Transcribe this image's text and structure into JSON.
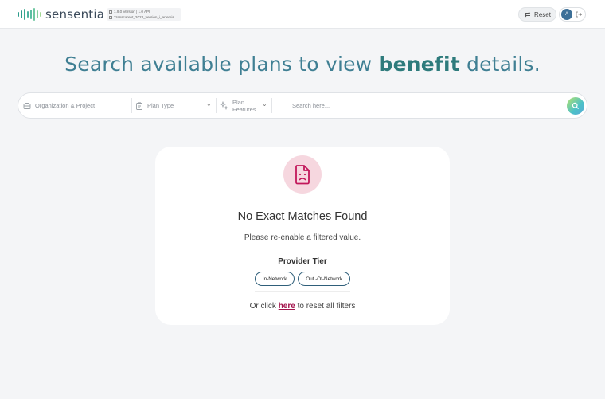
{
  "header": {
    "logo_text": "sensentia",
    "version_line1": "1.9.0 Version | 1.0 API",
    "version_line2": "Transcarent_2023_version_i_artemis",
    "reset_label": "Reset",
    "avatar_initial": "A"
  },
  "headline": {
    "part1": "Search available plans to view ",
    "emphasis": "benefit",
    "part2": " details."
  },
  "search": {
    "org_project": "Organization & Project",
    "plan_type": "Plan Type",
    "plan_features_line1": "Plan",
    "plan_features_line2": "Features",
    "placeholder": "Search here..."
  },
  "empty_state": {
    "title": "No Exact Matches Found",
    "subtitle": "Please re-enable a filtered value.",
    "tier_label": "Provider Tier",
    "tiers": [
      "In-Network",
      "Out -Of-Network"
    ],
    "reset_prefix": "Or click ",
    "reset_link": "here",
    "reset_suffix": " to reset all filters"
  },
  "colors": {
    "brand": "#3f7f93",
    "accent": "#a3154d",
    "error_bg": "#f6d7df"
  },
  "icons": {
    "org": "briefcase-icon",
    "plan_type": "clipboard-icon",
    "features": "sparkle-icon",
    "search": "search-icon",
    "empty": "sad-document-icon"
  }
}
